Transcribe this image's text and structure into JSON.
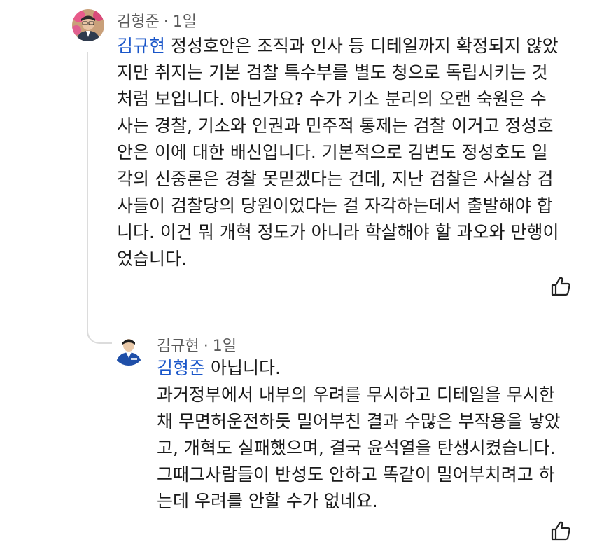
{
  "comment": {
    "author": "김형준",
    "time": "1일",
    "mention": "김규현",
    "lines": [
      "정성호안은 조직과 인사 등 디테일까지 확정되지 않았",
      "지만 취지는 기본 검찰 특수부를 별도 청으로 독립시키는 것",
      "처럼 보입니다.  아닌가요?  수가 기소 분리의 오랜 숙원은 수",
      "사는 경찰, 기소와 인권과 민주적 통제는 검찰 이거고 정성호",
      "안은 이에 대한 배신입니다.  기본적으로 김변도 정성호도 일",
      "각의 신중론은 경찰 못믿겠다는 건데, 지난 검찰은 사실상 검",
      "사들이 검찰당의 당원이었다는 걸 자각하는데서 출발해야 합",
      "니다.  이건 뭐 개혁 정도가 아니라 학살해야 할 과오와 만행이",
      "었습니다."
    ],
    "like_icon": "thumbs-up-icon"
  },
  "reply": {
    "author": "김규현",
    "time": "1일",
    "mention": "김형준",
    "first_text": "아닙니다.",
    "lines": [
      "과거정부에서 내부의 우려를 무시하고 디테일을 무시한",
      "채 무면허운전하듯 밀어부친 결과 수많은 부작용을 낳았",
      "고, 개혁도 실패했으며, 결국 윤석열을 탄생시켰습니다.",
      "그때그사람들이 반성도 안하고 똑같이 밀어부치려고 하",
      "는데 우려를 안할 수가 없네요."
    ],
    "like_icon": "thumbs-up-icon"
  },
  "separator": "·"
}
